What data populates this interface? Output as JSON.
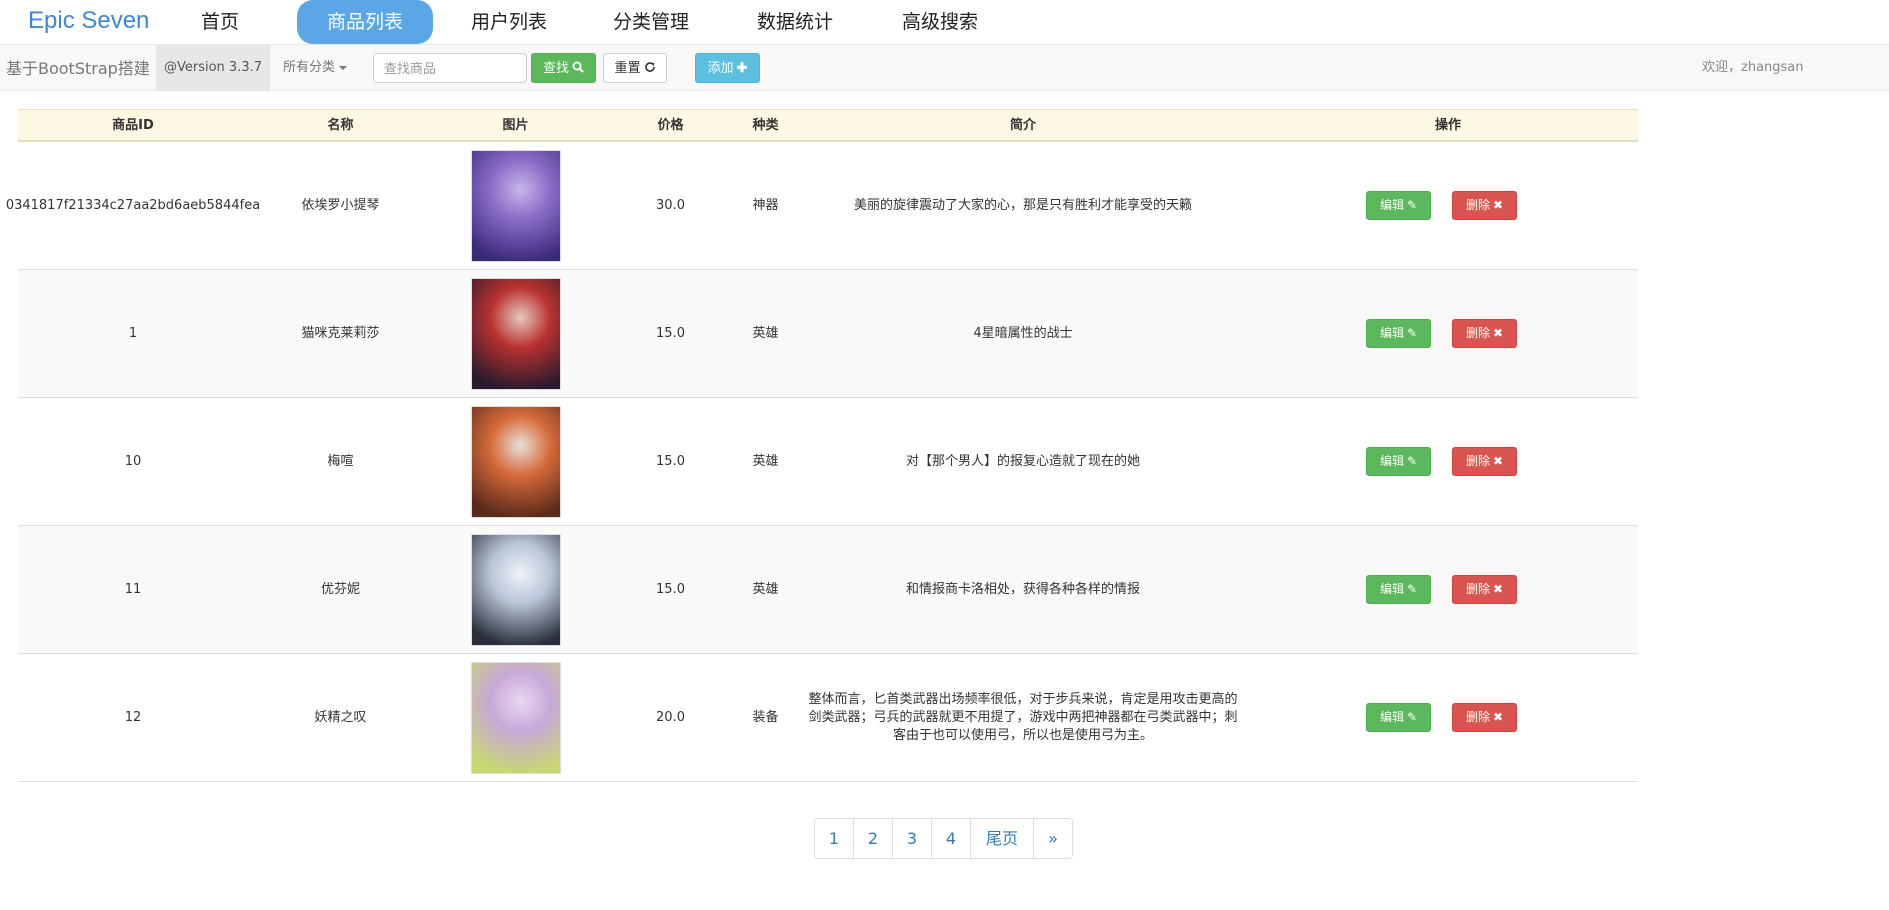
{
  "nav": {
    "brand": "Epic Seven",
    "items": [
      {
        "label": "首页",
        "active": false
      },
      {
        "label": "商品列表",
        "active": true
      },
      {
        "label": "用户列表",
        "active": false
      },
      {
        "label": "分类管理",
        "active": false
      },
      {
        "label": "数据统计",
        "active": false
      },
      {
        "label": "高级搜索",
        "active": false
      }
    ]
  },
  "toolbar": {
    "brand": "基于BootStrap搭建",
    "version": "@Version 3.3.7",
    "category": "所有分类",
    "search_placeholder": "查找商品",
    "search_label": "查找",
    "reset_label": "重置",
    "add_label": "添加",
    "welcome": "欢迎，zhangsan"
  },
  "table": {
    "headers": [
      "商品ID",
      "名称",
      "图片",
      "价格",
      "种类",
      "简介",
      "操作"
    ],
    "edit_label": "编辑",
    "delete_label": "删除",
    "rows": [
      {
        "id": "0341817f21334c27aa2bd6aeb5844fea",
        "name": "依埃罗小提琴",
        "price": "30.0",
        "type": "神器",
        "desc": "美丽的旋律震动了大家的心，那是只有胜利才能享受的天籁",
        "img_colors": [
          "#3b2a7a",
          "#8a6cc7",
          "#c9b5e8"
        ]
      },
      {
        "id": "1",
        "name": "猫咪克莱莉莎",
        "price": "15.0",
        "type": "英雄",
        "desc": "4星暗属性的战士",
        "img_colors": [
          "#2a1a2e",
          "#b8322f",
          "#e8c8c0"
        ]
      },
      {
        "id": "10",
        "name": "梅喧",
        "price": "15.0",
        "type": "英雄",
        "desc": "对【那个男人】的报复心造就了现在的她",
        "img_colors": [
          "#5a2a1a",
          "#d66a3a",
          "#e8e0d8"
        ]
      },
      {
        "id": "11",
        "name": "优芬妮",
        "price": "15.0",
        "type": "英雄",
        "desc": "和情报商卡洛相处，获得各种各样的情报",
        "img_colors": [
          "#2a2e3a",
          "#b8c4d8",
          "#f0f4f8"
        ]
      },
      {
        "id": "12",
        "name": "妖精之叹",
        "price": "20.0",
        "type": "装备",
        "desc": "整体而言，匕首类武器出场频率很低，对于步兵来说，肯定是用攻击更高的剑类武器；弓兵的武器就更不用提了，游戏中两把神器都在弓类武器中；刺客由于也可以使用弓，所以也是使用弓为主。",
        "img_colors": [
          "#c8d870",
          "#c8a8d8",
          "#e8d8f0"
        ]
      }
    ]
  },
  "pagination": [
    "1",
    "2",
    "3",
    "4",
    "尾页",
    "»"
  ]
}
